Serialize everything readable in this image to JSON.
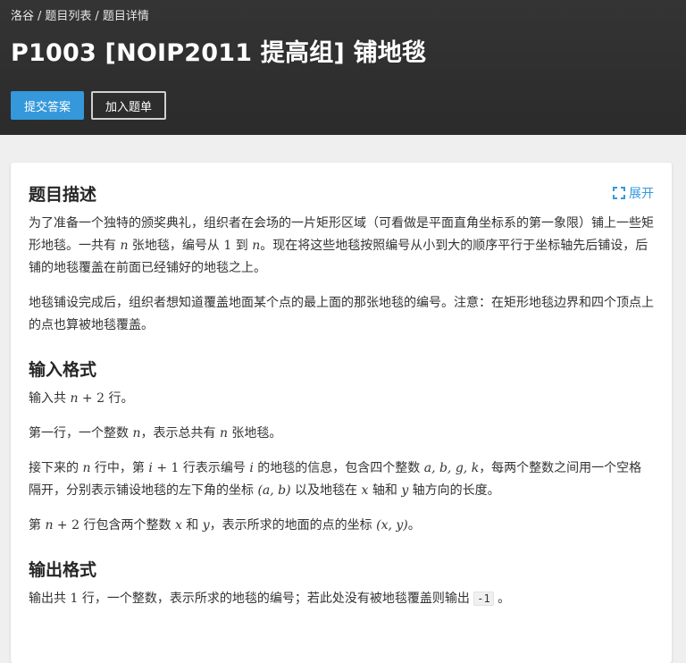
{
  "breadcrumb": {
    "site": "洛谷",
    "sep1": "/",
    "list": "题目列表",
    "sep2": "/",
    "detail": "题目详情"
  },
  "title": "P1003 [NOIP2011 提高组] 铺地毯",
  "buttons": {
    "submit": "提交答案",
    "add": "加入题单"
  },
  "colors": {
    "header_bg": "#2e2e2e",
    "accent": "#3498db"
  },
  "description": {
    "heading": "题目描述",
    "expand_label": "展开",
    "p1": [
      "为了准备一个独特的颁奖典礼，组织者在会场的一片矩形区域（可看做是平面直角坐标系的第一象限）铺上一些矩形地毯。一共有 ",
      "n",
      " 张地毯，编号从 ",
      "1",
      " 到 ",
      "n",
      "。现在将这些地毯按照编号从小到大的顺序平行于坐标轴先后铺设，后铺的地毯覆盖在前面已经铺好的地毯之上。"
    ],
    "p2": "地毯铺设完成后，组织者想知道覆盖地面某个点的最上面的那张地毯的编号。注意：在矩形地毯边界和四个顶点上的点也算被地毯覆盖。"
  },
  "input": {
    "heading": "输入格式",
    "p1": [
      "输入共 ",
      "n",
      " + 2",
      " 行。"
    ],
    "p2": [
      "第一行，一个整数 ",
      "n",
      "，表示总共有 ",
      "n",
      " 张地毯。"
    ],
    "p3": [
      "接下来的 ",
      "n",
      " 行中，第 ",
      "i",
      " + 1",
      " 行表示编号 ",
      "i",
      " 的地毯的信息，包含四个整数 ",
      "a, b, g, k",
      "，每两个整数之间用一个空格隔开，分别表示铺设地毯的左下角的坐标 ",
      "(a, b)",
      " 以及地毯在 ",
      "x",
      " 轴和 ",
      "y",
      " 轴方向的长度。"
    ],
    "p4": [
      "第 ",
      "n",
      " + 2",
      " 行包含两个整数 ",
      "x",
      " 和 ",
      "y",
      "，表示所求的地面的点的坐标 ",
      "(x, y)",
      "。"
    ]
  },
  "output": {
    "heading": "输出格式",
    "p1": [
      "输出共 ",
      "1",
      " 行，一个整数，表示所求的地毯的编号；若此处没有被地毯覆盖则输出 ",
      "-1",
      " 。"
    ]
  }
}
